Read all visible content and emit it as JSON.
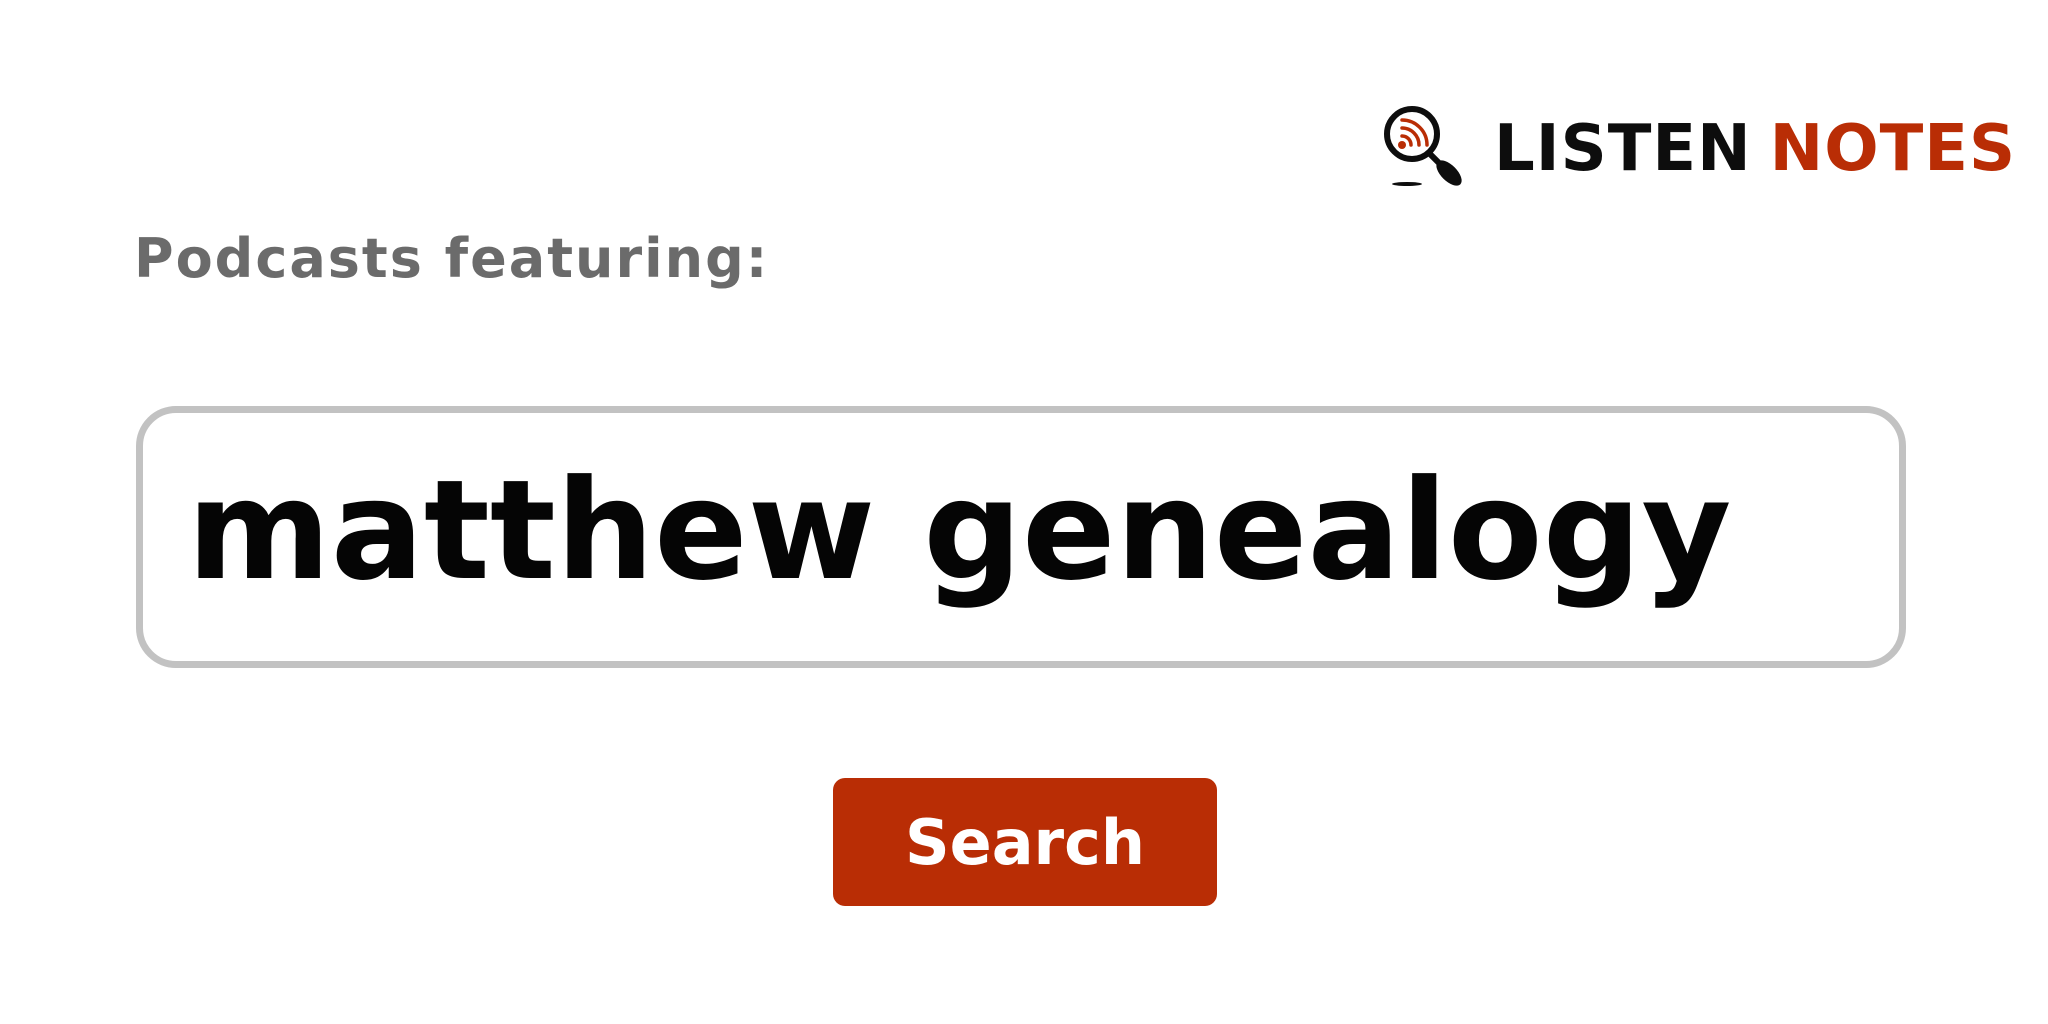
{
  "brand": {
    "word_dark": "LISTEN",
    "word_accent": "NOTES",
    "icon": "magnifier-podcast-icon",
    "dark_color": "#0d0d0d",
    "accent_color": "#b92d05"
  },
  "lead": {
    "label": "Podcasts featuring:"
  },
  "query": {
    "value": "matthew genealogy"
  },
  "search_button": {
    "label": "Search",
    "color": "#b92d05"
  }
}
